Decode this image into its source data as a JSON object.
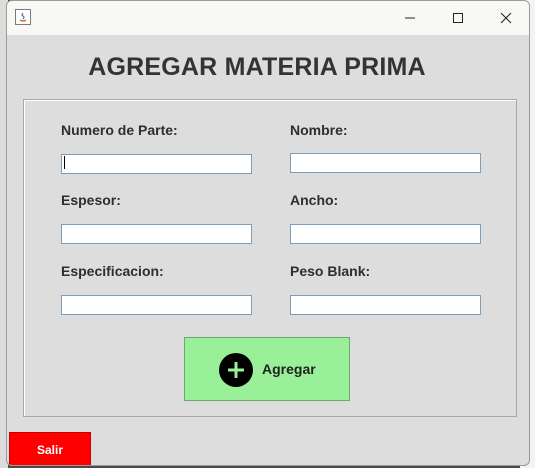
{
  "window": {
    "title": "",
    "controls": {
      "minimize": "minimize-icon",
      "maximize": "maximize-icon",
      "close": "close-icon"
    }
  },
  "heading": "AGREGAR MATERIA PRIMA",
  "form": {
    "fields": [
      {
        "label": "Numero de Parte:",
        "value": "",
        "placeholder": ""
      },
      {
        "label": "Nombre:",
        "value": "",
        "placeholder": ""
      },
      {
        "label": "Espesor:",
        "value": "",
        "placeholder": ""
      },
      {
        "label": "Ancho:",
        "value": "",
        "placeholder": ""
      },
      {
        "label": "Especificacion:",
        "value": "",
        "placeholder": ""
      },
      {
        "label": "Peso Blank:",
        "value": "",
        "placeholder": ""
      }
    ]
  },
  "buttons": {
    "add": {
      "label": "Agregar",
      "icon": "plus-circle-icon",
      "color": "#99f099"
    },
    "exit": {
      "label": "Salir",
      "color": "#ff0000"
    }
  }
}
